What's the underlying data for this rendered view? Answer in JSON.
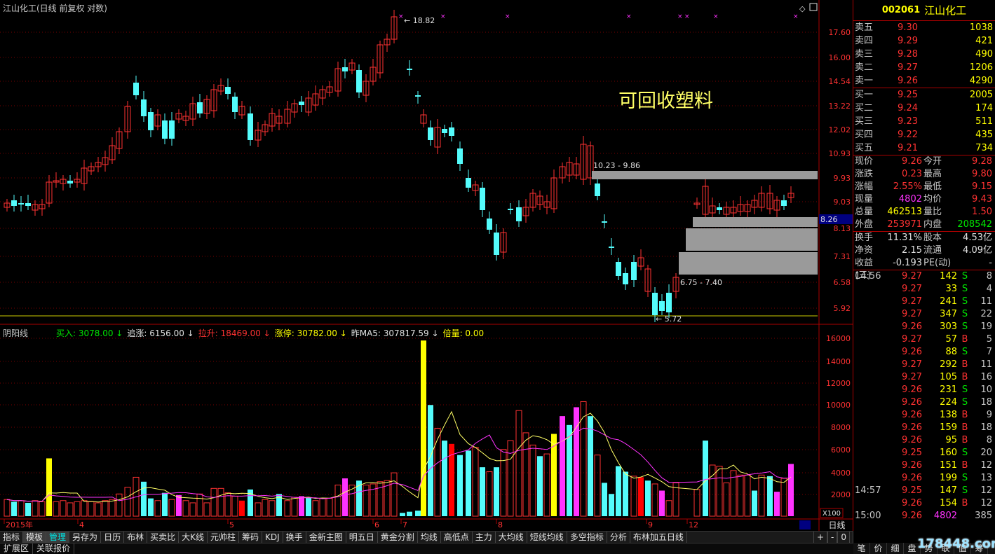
{
  "window": {
    "title": "江山化工(日线 前复权 对数)"
  },
  "annotation": "可回收塑料",
  "price_labels": {
    "high": "18.82",
    "low": "5.72",
    "range1": "10.23 - 9.86",
    "range2": "6.75 - 7.40",
    "current_marker": "8.26"
  },
  "y_axis": [
    "17.60",
    "16.00",
    "14.54",
    "13.22",
    "12.02",
    "10.93",
    "9.93",
    "9.03",
    "8.13",
    "7.31",
    "6.58",
    "5.92"
  ],
  "vol_axis": [
    "16000",
    "14000",
    "12000",
    "10000",
    "8000",
    "6000",
    "4000",
    "2000"
  ],
  "vol_unit": "X100",
  "x_axis": [
    "2015年",
    "4",
    "5",
    "6",
    "7",
    "8",
    "9",
    "12"
  ],
  "indicator": {
    "name": "阴阳线",
    "items": [
      {
        "label": "买入:",
        "value": "3078.00",
        "arrow": "↓",
        "color": "#00e600"
      },
      {
        "label": "追涨:",
        "value": "6156.00",
        "arrow": "↓",
        "color": "#e0e0e0"
      },
      {
        "label": "拉升:",
        "value": "18469.00",
        "arrow": "↓",
        "color": "#ff3232"
      },
      {
        "label": "涨停:",
        "value": "30782.00",
        "arrow": "↓",
        "color": "#ffff00"
      },
      {
        "label": "昨MA5:",
        "value": "307817.59",
        "arrow": "↓",
        "color": "#e0e0e0"
      },
      {
        "label": "倍量:",
        "value": "0.00",
        "arrow": "",
        "color": "#ffff00"
      }
    ]
  },
  "quote": {
    "code": "002061",
    "name": "江山化工",
    "asks": [
      {
        "label": "卖五",
        "price": "9.30",
        "vol": "1038"
      },
      {
        "label": "卖四",
        "price": "9.29",
        "vol": "421"
      },
      {
        "label": "卖三",
        "price": "9.28",
        "vol": "490"
      },
      {
        "label": "卖二",
        "price": "9.27",
        "vol": "1206"
      },
      {
        "label": "卖一",
        "price": "9.26",
        "vol": "4290"
      }
    ],
    "bids": [
      {
        "label": "买一",
        "price": "9.25",
        "vol": "2005"
      },
      {
        "label": "买二",
        "price": "9.24",
        "vol": "174"
      },
      {
        "label": "买三",
        "price": "9.23",
        "vol": "511"
      },
      {
        "label": "买四",
        "price": "9.22",
        "vol": "435"
      },
      {
        "label": "买五",
        "price": "9.21",
        "vol": "734"
      }
    ],
    "stats": [
      {
        "l1": "现价",
        "v1": "9.26",
        "c1": "red",
        "l2": "今开",
        "v2": "9.28",
        "c2": "red"
      },
      {
        "l1": "涨跌",
        "v1": "0.23",
        "c1": "red",
        "l2": "最高",
        "v2": "9.80",
        "c2": "red"
      },
      {
        "l1": "涨幅",
        "v1": "2.55%",
        "c1": "red",
        "l2": "最低",
        "v2": "9.15",
        "c2": "red"
      },
      {
        "l1": "现量",
        "v1": "4802",
        "c1": "mag",
        "l2": "均价",
        "v2": "9.43",
        "c2": "red"
      },
      {
        "l1": "总量",
        "v1": "462513",
        "c1": "yel",
        "l2": "量比",
        "v2": "1.50",
        "c2": "red"
      },
      {
        "l1": "外盘",
        "v1": "253971",
        "c1": "red",
        "l2": "内盘",
        "v2": "208542",
        "c2": "grn"
      }
    ],
    "stats2": [
      {
        "l1": "换手",
        "v1": "11.31%",
        "l2": "股本",
        "v2": "4.53亿"
      },
      {
        "l1": "净资",
        "v1": "2.15",
        "l2": "流通",
        "v2": "4.09亿"
      },
      {
        "l1": "收益(三)",
        "v1": "-0.193",
        "l2": "PE(动)",
        "v2": "-"
      }
    ],
    "ticks": [
      {
        "t": "14:56",
        "p": "9.27",
        "v": "142",
        "s": "S",
        "n": "8",
        "pc": "red",
        "sc": "grn"
      },
      {
        "t": "",
        "p": "9.27",
        "v": "33",
        "s": "S",
        "n": "4",
        "pc": "red",
        "sc": "grn"
      },
      {
        "t": "",
        "p": "9.27",
        "v": "241",
        "s": "S",
        "n": "11",
        "pc": "red",
        "sc": "grn"
      },
      {
        "t": "",
        "p": "9.27",
        "v": "347",
        "s": "S",
        "n": "22",
        "pc": "red",
        "sc": "grn"
      },
      {
        "t": "",
        "p": "9.26",
        "v": "303",
        "s": "S",
        "n": "19",
        "pc": "red",
        "sc": "grn"
      },
      {
        "t": "",
        "p": "9.27",
        "v": "57",
        "s": "B",
        "n": "5",
        "pc": "red",
        "sc": "red"
      },
      {
        "t": "",
        "p": "9.26",
        "v": "88",
        "s": "S",
        "n": "7",
        "pc": "red",
        "sc": "grn"
      },
      {
        "t": "",
        "p": "9.27",
        "v": "292",
        "s": "B",
        "n": "11",
        "pc": "red",
        "sc": "red"
      },
      {
        "t": "",
        "p": "9.27",
        "v": "105",
        "s": "B",
        "n": "16",
        "pc": "red",
        "sc": "red"
      },
      {
        "t": "",
        "p": "9.26",
        "v": "231",
        "s": "S",
        "n": "10",
        "pc": "red",
        "sc": "grn"
      },
      {
        "t": "",
        "p": "9.26",
        "v": "224",
        "s": "S",
        "n": "18",
        "pc": "red",
        "sc": "grn"
      },
      {
        "t": "",
        "p": "9.26",
        "v": "138",
        "s": "B",
        "n": "9",
        "pc": "red",
        "sc": "red"
      },
      {
        "t": "",
        "p": "9.26",
        "v": "159",
        "s": "B",
        "n": "18",
        "pc": "red",
        "sc": "red"
      },
      {
        "t": "",
        "p": "9.26",
        "v": "95",
        "s": "B",
        "n": "8",
        "pc": "red",
        "sc": "red"
      },
      {
        "t": "",
        "p": "9.25",
        "v": "160",
        "s": "S",
        "n": "20",
        "pc": "red",
        "sc": "grn"
      },
      {
        "t": "",
        "p": "9.26",
        "v": "151",
        "s": "B",
        "n": "12",
        "pc": "red",
        "sc": "red"
      },
      {
        "t": "",
        "p": "9.26",
        "v": "199",
        "s": "S",
        "n": "13",
        "pc": "red",
        "sc": "grn"
      },
      {
        "t": "14:57",
        "p": "9.25",
        "v": "147",
        "s": "S",
        "n": "12",
        "pc": "red",
        "sc": "grn"
      },
      {
        "t": "",
        "p": "9.26",
        "v": "154",
        "s": "B",
        "n": "12",
        "pc": "red",
        "sc": "red"
      },
      {
        "t": "15:00",
        "p": "9.26",
        "v": "4802",
        "s": "",
        "n": "385",
        "pc": "red",
        "sc": "red"
      }
    ]
  },
  "bottom_tabs": [
    "指标",
    "模板",
    "管理",
    "另存为",
    "日历",
    "布林",
    "买卖比",
    "大K线",
    "元帅柱",
    "筹码",
    "KDJ",
    "换手",
    "金新主图",
    "明五日",
    "黄金分割",
    "均线",
    "高低点",
    "主力",
    "大均线",
    "短线均线",
    "多空指标",
    "分析",
    "布林加五日线"
  ],
  "bottom_row2": [
    "扩展区",
    "关联报价"
  ],
  "right_tabs": [
    "笔",
    "价",
    "细",
    "盘",
    "势",
    "联",
    "值",
    "筹"
  ],
  "daily_label": "日线",
  "watermark": "178448.com"
}
